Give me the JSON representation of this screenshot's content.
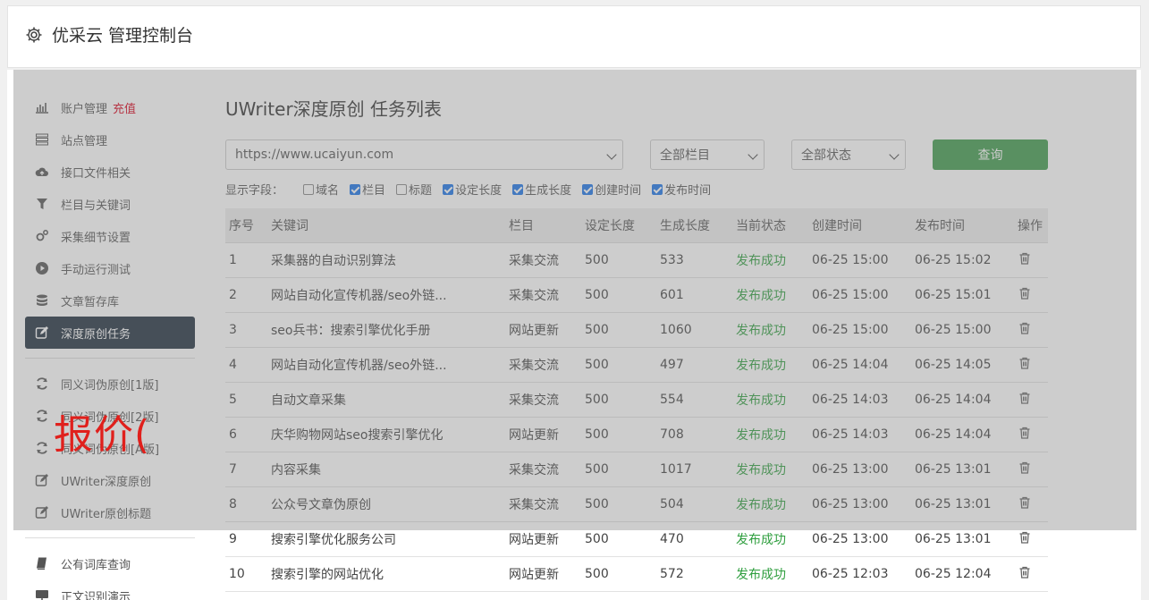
{
  "header": {
    "title": "优采云 管理控制台"
  },
  "sidebar": {
    "items": [
      {
        "label": "账户管理",
        "extra": "充值",
        "icon": "bar-chart-icon",
        "active": false
      },
      {
        "label": "站点管理",
        "icon": "server-icon",
        "active": false
      },
      {
        "label": "接口文件相关",
        "icon": "cloud-upload-icon",
        "active": false
      },
      {
        "label": "栏目与关键词",
        "icon": "filter-icon",
        "active": false
      },
      {
        "label": "采集细节设置",
        "icon": "gears-icon",
        "active": false
      },
      {
        "label": "手动运行测试",
        "icon": "play-circle-icon",
        "active": false
      },
      {
        "label": "文章暂存库",
        "icon": "database-icon",
        "active": false
      },
      {
        "label": "深度原创任务",
        "icon": "edit-icon",
        "active": true
      }
    ],
    "items2": [
      {
        "label": "同义词伪原创[1版]",
        "icon": "refresh-icon"
      },
      {
        "label": "同义词伪原创[2版]",
        "icon": "refresh-icon"
      },
      {
        "label": "同义词伪原创[A版]",
        "icon": "refresh-icon"
      },
      {
        "label": "UWriter深度原创",
        "icon": "edit-icon"
      },
      {
        "label": "UWriter原创标题",
        "icon": "edit-icon"
      }
    ],
    "items3": [
      {
        "label": "公有词库查询",
        "icon": "book-icon"
      },
      {
        "label": "正文识别演示",
        "icon": "monitor-icon"
      }
    ]
  },
  "main": {
    "title": "UWriter深度原创 任务列表",
    "filters": {
      "site": "https://www.ucaiyun.com",
      "column": "全部栏目",
      "status": "全部状态",
      "query_label": "查询"
    },
    "fields": {
      "label": "显示字段：",
      "options": [
        {
          "label": "域名",
          "checked": false
        },
        {
          "label": "栏目",
          "checked": true
        },
        {
          "label": "标题",
          "checked": false
        },
        {
          "label": "设定长度",
          "checked": true
        },
        {
          "label": "生成长度",
          "checked": true
        },
        {
          "label": "创建时间",
          "checked": true
        },
        {
          "label": "发布时间",
          "checked": true
        }
      ]
    },
    "table": {
      "headers": [
        "序号",
        "关键词",
        "栏目",
        "设定长度",
        "生成长度",
        "当前状态",
        "创建时间",
        "发布时间",
        "操作"
      ],
      "rows": [
        [
          "1",
          "采集器的自动识别算法",
          "采集交流",
          "500",
          "533",
          "发布成功",
          "06-25 15:00",
          "06-25 15:02"
        ],
        [
          "2",
          "网站自动化宣传机器/seo外链...",
          "采集交流",
          "500",
          "601",
          "发布成功",
          "06-25 15:00",
          "06-25 15:01"
        ],
        [
          "3",
          "seo兵书：搜索引擎优化手册",
          "网站更新",
          "500",
          "1060",
          "发布成功",
          "06-25 15:00",
          "06-25 15:00"
        ],
        [
          "4",
          "网站自动化宣传机器/seo外链...",
          "采集交流",
          "500",
          "497",
          "发布成功",
          "06-25 14:04",
          "06-25 14:05"
        ],
        [
          "5",
          "自动文章采集",
          "采集交流",
          "500",
          "554",
          "发布成功",
          "06-25 14:03",
          "06-25 14:04"
        ],
        [
          "6",
          "庆华购物网站seo搜索引擎优化",
          "网站更新",
          "500",
          "708",
          "发布成功",
          "06-25 14:03",
          "06-25 14:04"
        ],
        [
          "7",
          "内容采集",
          "采集交流",
          "500",
          "1017",
          "发布成功",
          "06-25 13:00",
          "06-25 13:01"
        ],
        [
          "8",
          "公众号文章伪原创",
          "采集交流",
          "500",
          "504",
          "发布成功",
          "06-25 13:00",
          "06-25 13:01"
        ],
        [
          "9",
          "搜索引擎优化服务公司",
          "网站更新",
          "500",
          "470",
          "发布成功",
          "06-25 13:00",
          "06-25 13:01"
        ],
        [
          "10",
          "搜索引擎的网站优化",
          "网站更新",
          "500",
          "572",
          "发布成功",
          "06-25 12:03",
          "06-25 12:04"
        ]
      ]
    }
  },
  "watermark": "报价(",
  "colors": {
    "active_nav": "#1f2d3d",
    "query_btn": "#3e9a4b",
    "status_ok": "#2e9e3e",
    "recharge": "#d9001b",
    "watermark": "#e0201c"
  }
}
